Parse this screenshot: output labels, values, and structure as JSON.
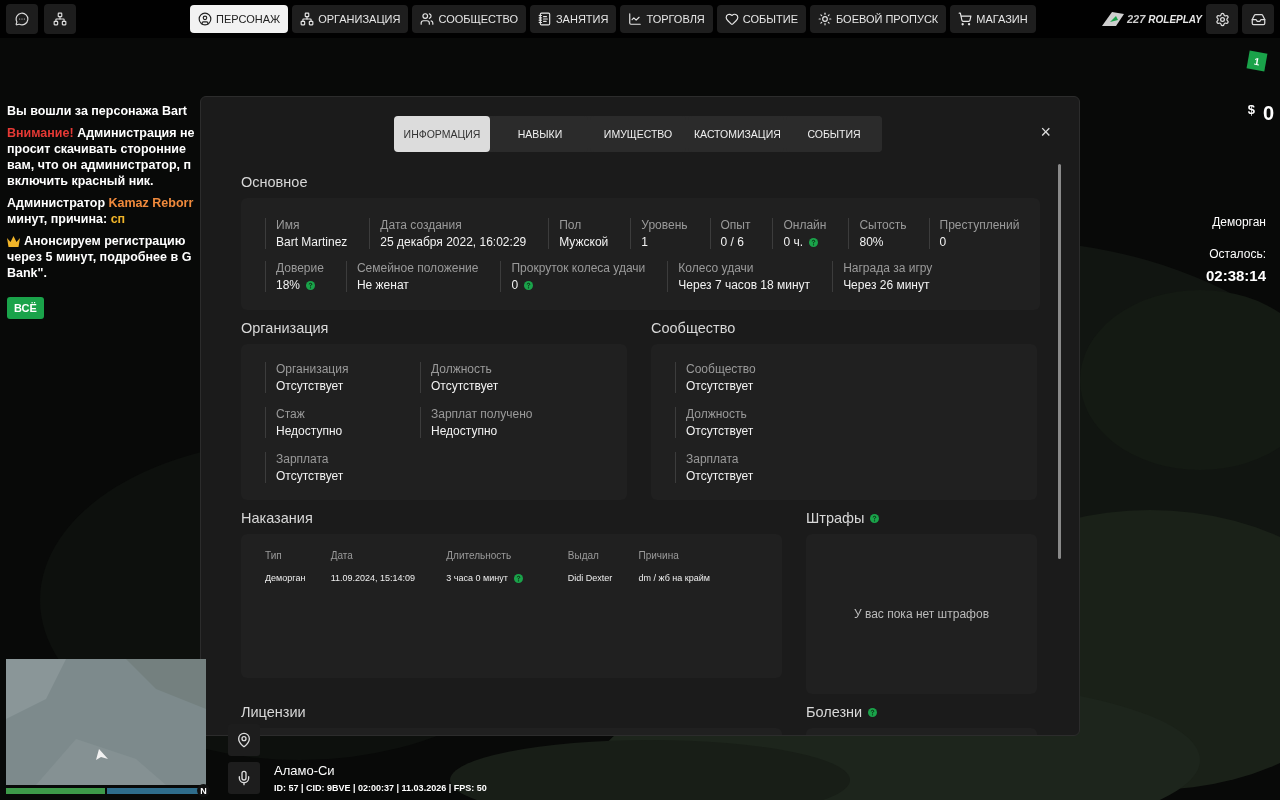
{
  "nav": {
    "tabs": [
      {
        "label": "ПЕРСОНАЖ",
        "selected": true
      },
      {
        "label": "ОРГАНИЗАЦИЯ",
        "selected": false
      },
      {
        "label": "СООБЩЕСТВО",
        "selected": false
      },
      {
        "label": "ЗАНЯТИЯ",
        "selected": false
      },
      {
        "label": "ТОРГОВЛЯ",
        "selected": false
      },
      {
        "label": "СОБЫТИЕ",
        "selected": false
      },
      {
        "label": "БОЕВОЙ ПРОПУСК",
        "selected": false
      },
      {
        "label": "МАГАЗИН",
        "selected": false
      }
    ],
    "logo": {
      "number": "227",
      "word": "ROLEPLAY",
      "badge": "1"
    }
  },
  "chat": {
    "messages": [
      {
        "crown": false,
        "lines": [
          [
            {
              "text": "Вы вошли за персонажа Bart",
              "color": "#ffffff"
            }
          ]
        ]
      },
      {
        "crown": false,
        "lines": [
          [
            {
              "text": "Внимание!",
              "color": "#e53935"
            },
            {
              "text": " Администрация не",
              "color": "#ffffff"
            }
          ],
          [
            {
              "text": "просит скачивать сторонние",
              "color": "#ffffff"
            }
          ],
          [
            {
              "text": "вам, что он администратор, п",
              "color": "#ffffff"
            }
          ],
          [
            {
              "text": "включить красный ник.",
              "color": "#ffffff"
            }
          ]
        ]
      },
      {
        "crown": false,
        "lines": [
          [
            {
              "text": "Администратор ",
              "color": "#ffffff"
            },
            {
              "text": "Kamaz Reborr",
              "color": "#f08a3c"
            }
          ],
          [
            {
              "text": "минут, причина: ",
              "color": "#ffffff"
            },
            {
              "text": "сп",
              "color": "#f0b429"
            }
          ]
        ]
      },
      {
        "crown": true,
        "lines": [
          [
            {
              "text": "Анонсируем регистрацию",
              "color": "#ffffff"
            }
          ],
          [
            {
              "text": "через 5 минут, подробнее в G",
              "color": "#ffffff"
            }
          ],
          [
            {
              "text": "Bank\".",
              "color": "#ffffff"
            }
          ]
        ]
      }
    ],
    "filter_button": "ВСЁ"
  },
  "money": {
    "symbol": "$",
    "amount": "0"
  },
  "jail": {
    "title": "Деморган",
    "remaining_label": "Осталось:",
    "time": "02:38:14"
  },
  "modal": {
    "tabs": [
      {
        "label": "ИНФОРМАЦИЯ",
        "selected": true
      },
      {
        "label": "НАВЫКИ",
        "selected": false
      },
      {
        "label": "ИМУЩЕСТВО",
        "selected": false
      },
      {
        "label": "КАСТОМИЗАЦИЯ",
        "selected": false
      },
      {
        "label": "СОБЫТИЯ",
        "selected": false
      }
    ],
    "close": "×",
    "basic": {
      "title": "Основное",
      "groups": [
        {
          "fields": [
            {
              "label": "Имя",
              "value": "Bart Martinez",
              "help": false
            },
            {
              "label": "Дата создания",
              "value": "25 декабря 2022, 16:02:29",
              "help": false
            },
            {
              "label": "Пол",
              "value": "Мужской",
              "help": false
            },
            {
              "label": "Уровень",
              "value": "1",
              "help": false
            },
            {
              "label": "Опыт",
              "value": "0 / 6",
              "help": false
            },
            {
              "label": "Онлайн",
              "value": "0 ч.",
              "help": true
            },
            {
              "label": "Сытость",
              "value": "80%",
              "help": false
            },
            {
              "label": "Преступлений",
              "value": "0",
              "help": false
            }
          ]
        },
        {
          "fields": [
            {
              "label": "Доверие",
              "value": "18%",
              "help": true
            },
            {
              "label": "Семейное положение",
              "value": "Не женат",
              "help": false
            },
            {
              "label": "Прокруток колеса удачи",
              "value": "0",
              "help": true
            },
            {
              "label": "Колесо удачи",
              "value": "Через 7 часов 18 минут",
              "help": false
            },
            {
              "label": "Награда за игру",
              "value": "Через 26 минут",
              "help": false
            }
          ]
        }
      ]
    },
    "organization": {
      "title": "Организация",
      "fields": [
        {
          "label": "Организация",
          "value": "Отсутствует"
        },
        {
          "label": "Должность",
          "value": "Отсутствует"
        },
        {
          "label": "Стаж",
          "value": "Недоступно"
        },
        {
          "label": "Зарплат получено",
          "value": "Недоступно"
        },
        {
          "label": "Зарплата",
          "value": "Отсутствует"
        }
      ]
    },
    "community": {
      "title": "Сообщество",
      "fields": [
        {
          "label": "Сообщество",
          "value": "Отсутствует"
        },
        {
          "label": "Должность",
          "value": "Отсутствует"
        },
        {
          "label": "Зарплата",
          "value": "Отсутствует"
        }
      ]
    },
    "punishments": {
      "title": "Наказания",
      "columns": [
        "Тип",
        "Дата",
        "Длительность",
        "Выдал",
        "Причина"
      ],
      "rows": [
        [
          {
            "text": "Деморган",
            "help": false
          },
          {
            "text": "11.09.2024, 15:14:09",
            "help": false
          },
          {
            "text": "3 часа 0 минут",
            "help": true
          },
          {
            "text": "Didi Dexter",
            "help": false
          },
          {
            "text": "dm / жб на крайм",
            "help": false
          }
        ]
      ]
    },
    "fines": {
      "title": "Штрафы",
      "empty": "У вас пока нет штрафов"
    },
    "licenses": {
      "title": "Лицензии"
    },
    "diseases": {
      "title": "Болезни"
    }
  },
  "status": {
    "location": "Аламо-Си",
    "info": "ID: 57 | CID: 9BVE | 02:00:37 | 11.03.2026 | FPS: 50",
    "compass": "N",
    "health": {
      "level": 1
    },
    "armor": {
      "level": 1
    }
  }
}
